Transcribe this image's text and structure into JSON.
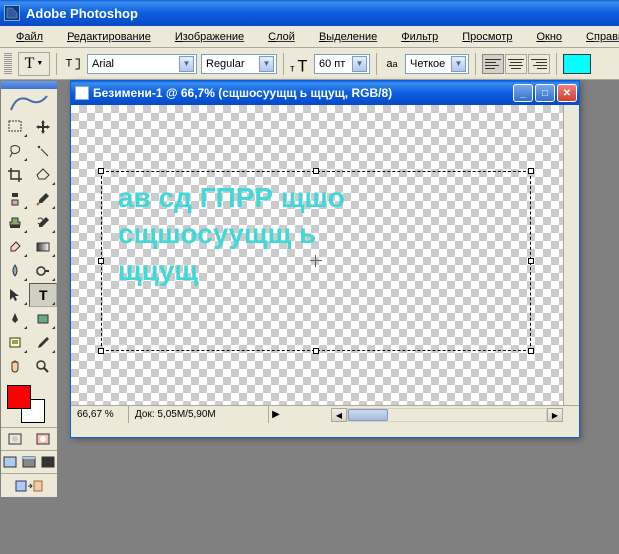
{
  "app": {
    "title": "Adobe Photoshop"
  },
  "menu": {
    "file": "Файл",
    "edit": "Редактирование",
    "image": "Изображение",
    "layer": "Слой",
    "select": "Выделение",
    "filter": "Фильтр",
    "view": "Просмотр",
    "window": "Окно",
    "help": "Справка"
  },
  "options": {
    "font_family": "Arial",
    "font_style": "Regular",
    "font_size": "60 пт",
    "aa_mode": "Четкое",
    "text_color": "#00ffff"
  },
  "document": {
    "title": "Безимени-1 @ 66,7% (сщшосуущщ ь щцущ, RGB/8)",
    "text_line1": "ав сд ГПРР щшо",
    "text_line2": "сщшосуущщ ь",
    "text_line3": "щцущ"
  },
  "status": {
    "zoom": "66,67 %",
    "doc_size": "Док: 5,05M/5,90M"
  },
  "colors": {
    "foreground": "#ff0000",
    "background": "#ffffff"
  }
}
